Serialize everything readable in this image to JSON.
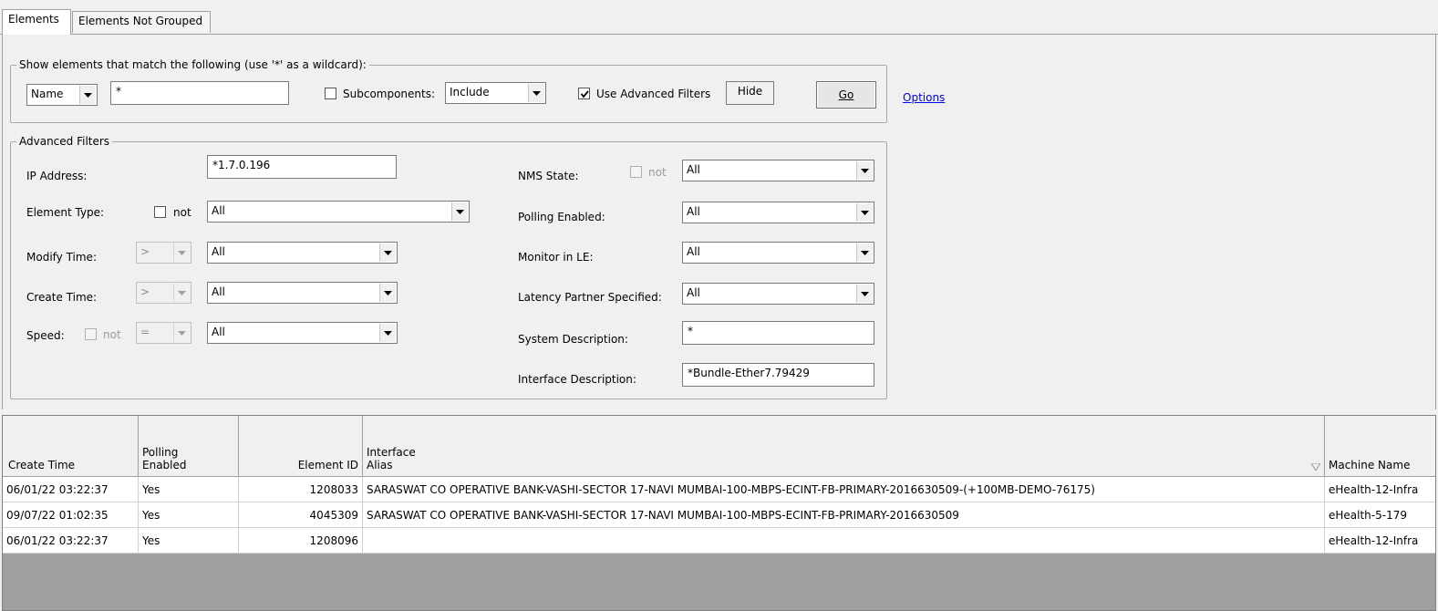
{
  "tabs": [
    {
      "label": "Elements",
      "active": true
    },
    {
      "label": "Elements Not Grouped",
      "active": false
    }
  ],
  "filter": {
    "legend": "Show elements that match the following (use '*' as a wildcard):",
    "field_select": "Name",
    "pattern": "*",
    "subcomponents_label": "Subcomponents:",
    "subcomponents_value": "Include",
    "subcomponents_checked": false,
    "use_advanced_label": "Use Advanced Filters",
    "use_advanced_checked": true,
    "hide_label": "Hide",
    "go_label": "Go",
    "options_link": "Options"
  },
  "advanced": {
    "legend": "Advanced Filters",
    "ip_address": {
      "label": "IP Address:",
      "value": "*1.7.0.196"
    },
    "element_type": {
      "label": "Element Type:",
      "not_label": "not",
      "value": "All"
    },
    "modify_time": {
      "label": "Modify Time:",
      "operator": ">",
      "value": "All"
    },
    "create_time": {
      "label": "Create Time:",
      "operator": ">",
      "value": "All"
    },
    "speed": {
      "label": "Speed:",
      "not_label": "not",
      "operator": "=",
      "value": "All"
    },
    "nms_state": {
      "label": "NMS State:",
      "not_label": "not",
      "value": "All"
    },
    "polling_enabled": {
      "label": "Polling Enabled:",
      "value": "All"
    },
    "monitor_in_le": {
      "label": "Monitor in LE:",
      "value": "All"
    },
    "latency_partner": {
      "label": "Latency Partner Specified:",
      "value": "All"
    },
    "system_description": {
      "label": "System Description:",
      "value": "*"
    },
    "interface_description": {
      "label": "Interface Description:",
      "value": "*Bundle-Ether7.79429"
    }
  },
  "grid": {
    "columns": {
      "create_time": "Create Time",
      "polling_line1": "Polling",
      "polling_line2": "Enabled",
      "element_id": "Element ID",
      "alias_line1": "Interface",
      "alias_line2": "Alias",
      "machine": "Machine Name"
    },
    "rows": [
      {
        "create_time": "06/01/22 03:22:37",
        "polling": "Yes",
        "element_id": "1208033",
        "alias": "SARASWAT CO OPERATIVE BANK-VASHI-SECTOR 17-NAVI MUMBAI-100-MBPS-ECINT-FB-PRIMARY-2016630509-(+100MB-DEMO-76175)",
        "machine": "eHealth-12-Infra"
      },
      {
        "create_time": "09/07/22 01:02:35",
        "polling": "Yes",
        "element_id": "4045309",
        "alias": "SARASWAT CO OPERATIVE BANK-VASHI-SECTOR 17-NAVI MUMBAI-100-MBPS-ECINT-FB-PRIMARY-2016630509",
        "machine": "eHealth-5-179"
      },
      {
        "create_time": "06/01/22 03:22:37",
        "polling": "Yes",
        "element_id": "1208096",
        "alias": "",
        "machine": "eHealth-12-Infra"
      }
    ]
  }
}
